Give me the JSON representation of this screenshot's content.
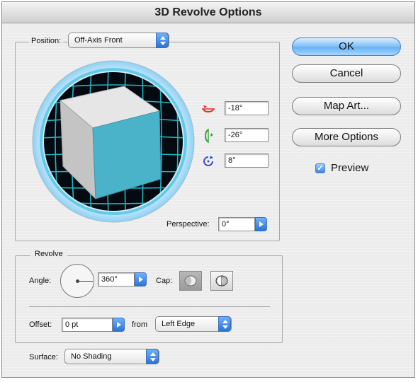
{
  "window": {
    "title": "3D Revolve Options"
  },
  "position": {
    "label": "Position:",
    "preset": "Off-Axis Front",
    "x_rotation": "-18°",
    "y_rotation": "-26°",
    "z_rotation": "8°",
    "perspective_label": "Perspective:",
    "perspective_value": "0°"
  },
  "revolve": {
    "legend": "Revolve",
    "angle_label": "Angle:",
    "angle_value": "360°",
    "cap_label": "Cap:",
    "offset_label": "Offset:",
    "offset_value": "0 pt",
    "from_label": "from",
    "from_value": "Left Edge"
  },
  "surface": {
    "label": "Surface:",
    "value": "No Shading"
  },
  "buttons": {
    "ok": "OK",
    "cancel": "Cancel",
    "map_art": "Map Art...",
    "more_options": "More Options"
  },
  "preview": {
    "label": "Preview",
    "checked": true
  },
  "colors": {
    "cube_side": "#4ab3c9",
    "cube_front": "#c9c9c9",
    "grid": "#1fb6c4",
    "accent": "#2a73d6"
  }
}
